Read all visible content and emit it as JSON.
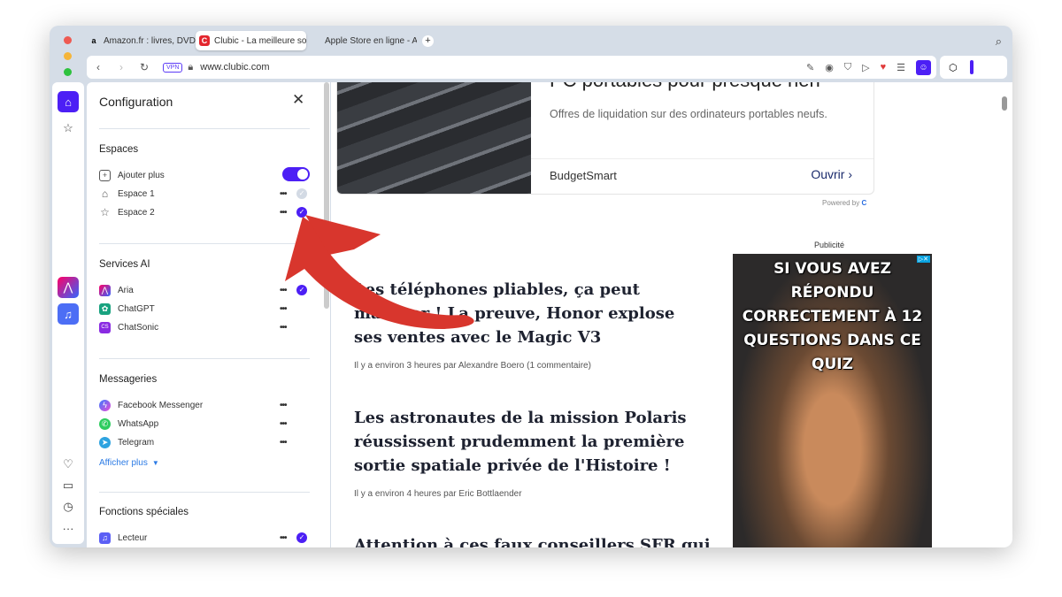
{
  "tabs": [
    {
      "title": "Amazon.fr : livres, DVD, jeux",
      "icon": "amazon-icon"
    },
    {
      "title": "Clubic - La meilleure source",
      "icon": "clubic-icon",
      "active": true
    },
    {
      "title": "Apple Store en ligne - Apple",
      "icon": "apple-icon"
    }
  ],
  "address": {
    "vpn": "VPN",
    "url": "www.clubic.com"
  },
  "panel": {
    "title": "Configuration",
    "espaces": {
      "title": "Espaces",
      "enabled": true,
      "items": [
        {
          "label": "Ajouter plus"
        },
        {
          "label": "Espace 1",
          "checked": false
        },
        {
          "label": "Espace 2",
          "checked": true
        }
      ]
    },
    "services": {
      "title": "Services AI",
      "items": [
        {
          "label": "Aria",
          "checked": true
        },
        {
          "label": "ChatGPT"
        },
        {
          "label": "ChatSonic"
        }
      ]
    },
    "messageries": {
      "title": "Messageries",
      "items": [
        {
          "label": "Facebook Messenger"
        },
        {
          "label": "WhatsApp"
        },
        {
          "label": "Telegram"
        }
      ],
      "more": "Afficher plus"
    },
    "fonctions": {
      "title": "Fonctions spéciales",
      "items": [
        {
          "label": "Lecteur",
          "checked": true
        }
      ]
    }
  },
  "ad": {
    "title": "PC portables pour presque rien",
    "desc": "Offres de liquidation sur des ordinateurs portables neufs.",
    "brand": "BudgetSmart",
    "cta": "Ouvrir",
    "powered": "Powered by"
  },
  "articles": [
    {
      "title": "Les téléphones pliables, ça peut marcher ! La preuve, Honor explose ses ventes avec le Magic V3",
      "meta": "Il y a environ 3 heures  par Alexandre Boero  (1 commentaire)"
    },
    {
      "title": "Les astronautes de la mission Polaris réussissent prudemment la première sortie spatiale privée de l'Histoire !",
      "meta": "Il y a environ 4 heures  par Eric Bottlaender"
    },
    {
      "title": "Attention à ces faux conseillers SFR qui"
    }
  ],
  "sidead": {
    "label": "Publicité",
    "text": "SI VOUS AVEZ RÉPONDU CORRECTEMENT À 12 QUESTIONS DANS CE QUIZ"
  },
  "colors": {
    "accent": "#4c1ff5",
    "arrow": "#d8362d"
  }
}
